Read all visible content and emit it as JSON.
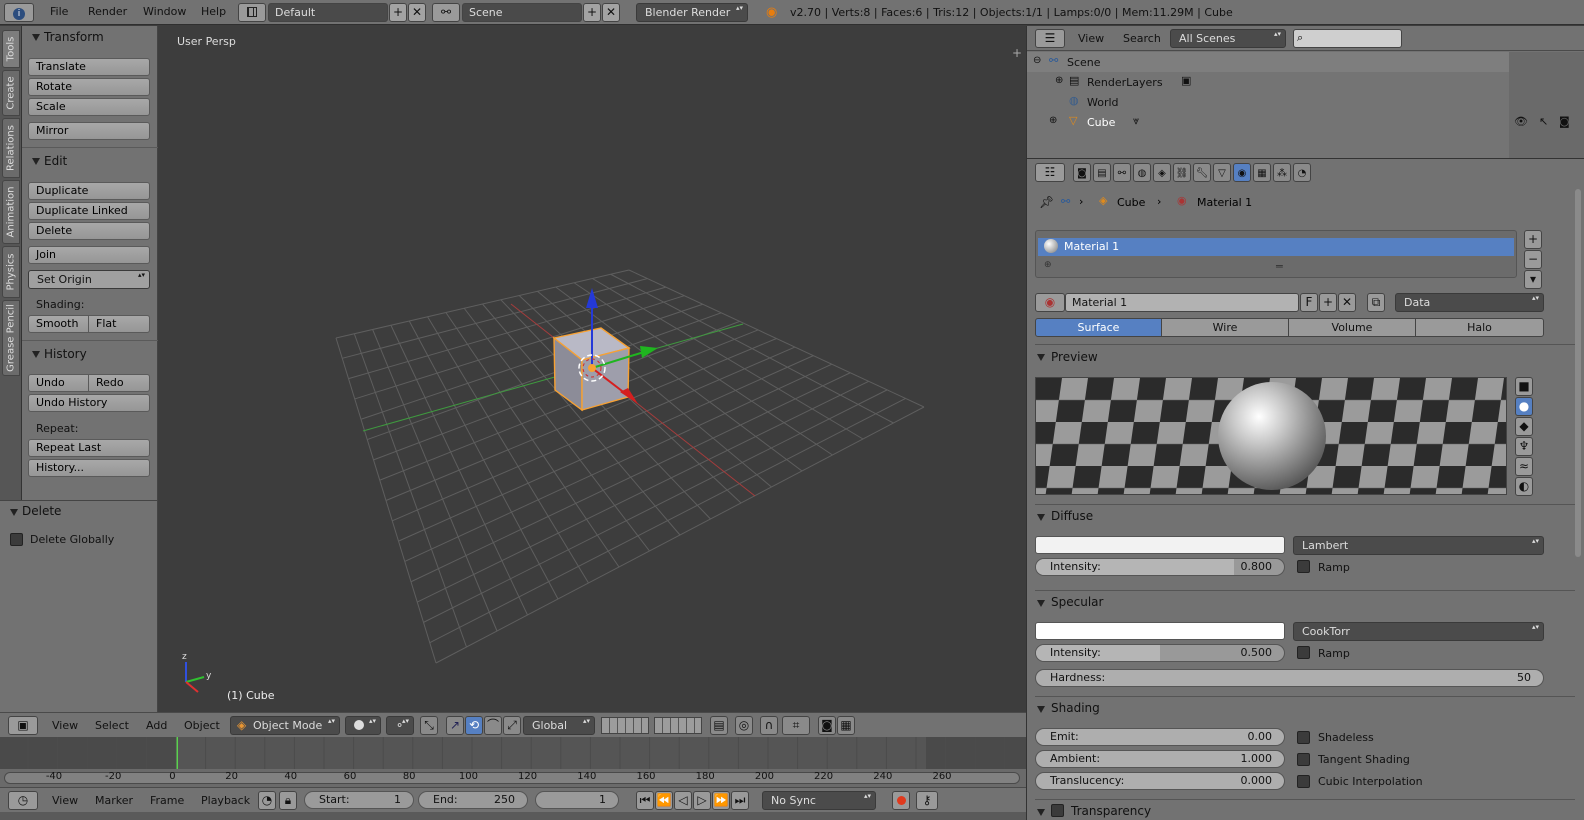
{
  "topbar": {
    "menus": [
      "File",
      "Render",
      "Window",
      "Help"
    ],
    "layout": "Default",
    "scene": "Scene",
    "engine": "Blender Render",
    "stats": "v2.70 | Verts:8 | Faces:6 | Tris:12 | Objects:1/1 | Lamps:0/0 | Mem:11.29M | Cube"
  },
  "tabs": [
    "Tools",
    "Create",
    "Relations",
    "Animation",
    "Physics",
    "Grease Pencil"
  ],
  "tools": {
    "transform": {
      "title": "Transform",
      "items": [
        "Translate",
        "Rotate",
        "Scale",
        "Mirror"
      ]
    },
    "edit": {
      "title": "Edit",
      "items": [
        "Duplicate",
        "Duplicate Linked",
        "Delete",
        "Join"
      ],
      "set_origin": "Set Origin",
      "shading_label": "Shading:",
      "smooth": "Smooth",
      "flat": "Flat"
    },
    "history": {
      "title": "History",
      "undo": "Undo",
      "redo": "Redo",
      "undo_history": "Undo History",
      "repeat_label": "Repeat:",
      "repeat_last": "Repeat Last",
      "history": "History..."
    }
  },
  "operator": {
    "title": "Delete",
    "option": "Delete Globally",
    "checked": false
  },
  "viewport": {
    "label": "User Persp",
    "object_label": "(1) Cube"
  },
  "view_header": {
    "menus": [
      "View",
      "Select",
      "Add",
      "Object"
    ],
    "mode": "Object Mode",
    "orientation": "Global"
  },
  "timeline": {
    "ticks": [
      "-40",
      "-20",
      "0",
      "20",
      "40",
      "60",
      "80",
      "100",
      "120",
      "140",
      "160",
      "180",
      "200",
      "220",
      "240",
      "260"
    ],
    "menus": [
      "View",
      "Marker",
      "Frame",
      "Playback"
    ],
    "start_label": "Start:",
    "start": "1",
    "end_label": "End:",
    "end": "250",
    "current": "1",
    "sync": "No Sync"
  },
  "outliner": {
    "menus": [
      "View",
      "Search"
    ],
    "filter": "All Scenes",
    "items": [
      "Scene",
      "RenderLayers",
      "World",
      "Cube"
    ]
  },
  "properties": {
    "breadcrumb": [
      "Cube",
      "Material 1"
    ],
    "slot": "Material 1",
    "material_name": "Material 1",
    "fake_user": "F",
    "link": "Data",
    "tabs": [
      "Surface",
      "Wire",
      "Volume",
      "Halo"
    ],
    "active_tab": "Surface",
    "preview_title": "Preview",
    "diffuse": {
      "title": "Diffuse",
      "shader": "Lambert",
      "intensity_label": "Intensity:",
      "intensity": "0.800",
      "intensity_fraction": 0.8,
      "ramp": "Ramp",
      "color": "#f2f2f2"
    },
    "specular": {
      "title": "Specular",
      "shader": "CookTorr",
      "intensity_label": "Intensity:",
      "intensity": "0.500",
      "intensity_fraction": 0.5,
      "ramp": "Ramp",
      "hardness_label": "Hardness:",
      "hardness": "50",
      "color": "#ffffff"
    },
    "shading": {
      "title": "Shading",
      "emit_label": "Emit:",
      "emit": "0.00",
      "ambient_label": "Ambient:",
      "ambient": "1.000",
      "translucency_label": "Translucency:",
      "translucency": "0.000",
      "shadeless": "Shadeless",
      "tangent": "Tangent Shading",
      "cubic": "Cubic Interpolation"
    },
    "transparency_title": "Transparency"
  },
  "colors": {
    "accent": "#5680c2",
    "header": "#727272",
    "viewport": "#3d3d3d",
    "selection": "#f7a133"
  }
}
